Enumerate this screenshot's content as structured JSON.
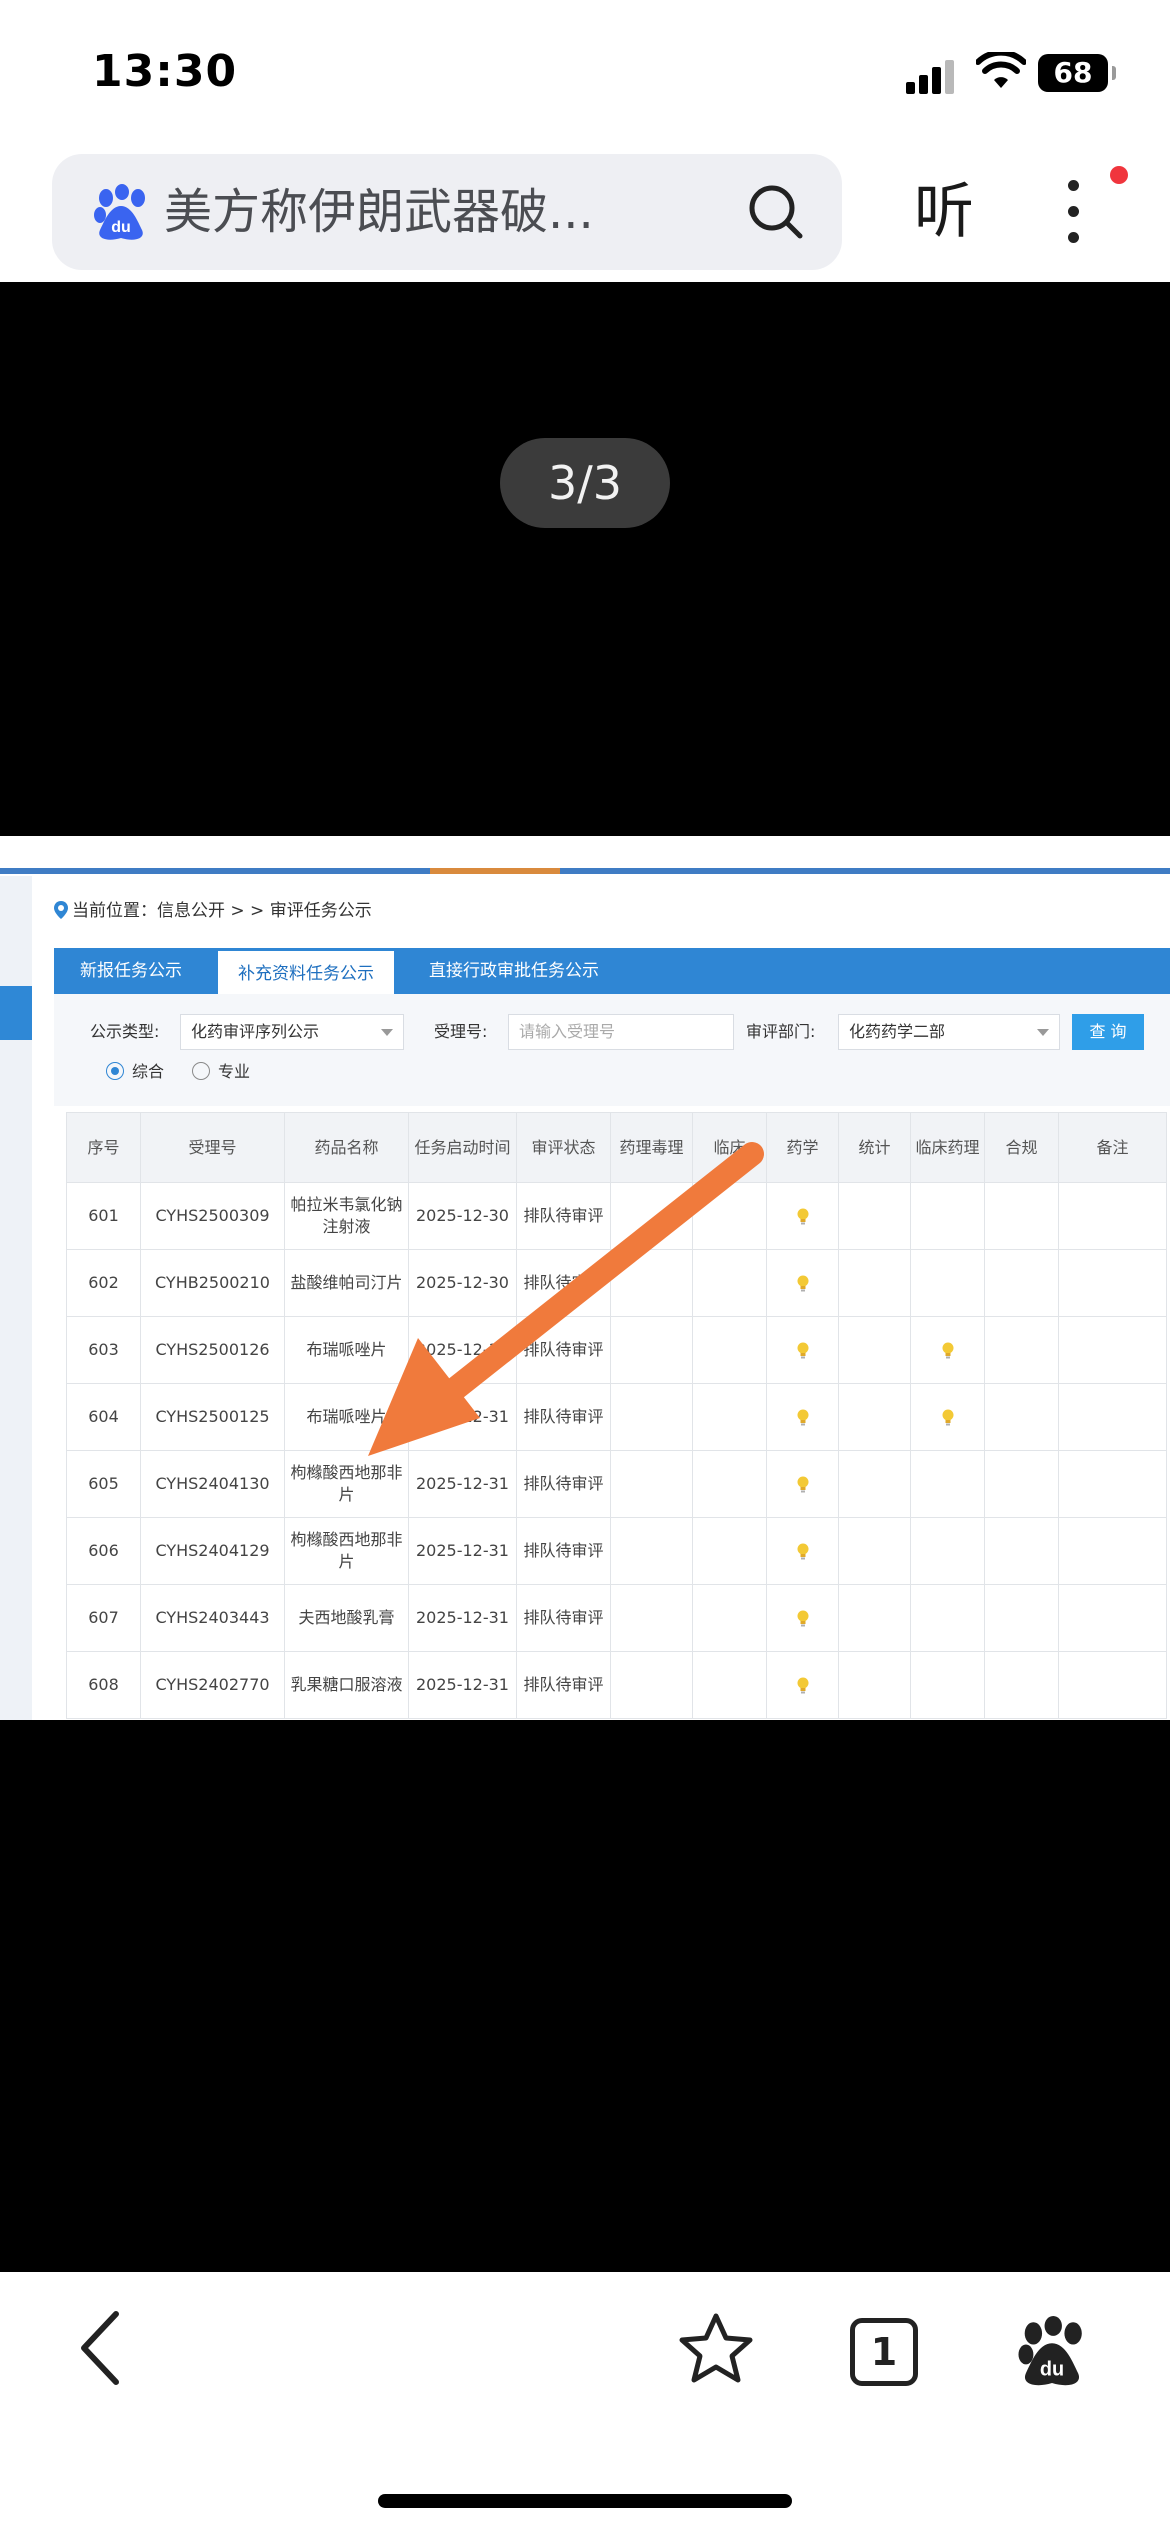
{
  "status": {
    "time": "13:30",
    "battery": "68"
  },
  "address_bar": {
    "query": "美方称伊朗武器破...",
    "listen_label": "听"
  },
  "viewer": {
    "counter": "3/3"
  },
  "page": {
    "breadcrumb": "当前位置：信息公开 > > 审评任务公示",
    "tabs": [
      "新报任务公示",
      "补充资料任务公示",
      "直接行政审批任务公示"
    ],
    "active_tab": 1,
    "filter": {
      "type_label": "公示类型:",
      "type_value": "化药审评序列公示",
      "accept_label": "受理号:",
      "accept_placeholder": "请输入受理号",
      "dept_label": "审评部门:",
      "dept_value": "化药药学二部",
      "query_button": "查 询",
      "radio_options": [
        "综合",
        "专业"
      ],
      "radio_selected": 0
    },
    "table": {
      "headers": [
        "序号",
        "受理号",
        "药品名称",
        "任务启动时间",
        "审评状态",
        "药理毒理",
        "临床",
        "药学",
        "统计",
        "临床药理",
        "合规",
        "备注"
      ],
      "rows": [
        {
          "no": "601",
          "accept": "CYHS2500309",
          "drug": "帕拉米韦氯化钠注射液",
          "date": "2025-12-30",
          "status": "排队待审评",
          "pharm": true,
          "clinpharm": false
        },
        {
          "no": "602",
          "accept": "CYHB2500210",
          "drug": "盐酸维帕司汀片",
          "date": "2025-12-30",
          "status": "排队待审评",
          "pharm": true,
          "clinpharm": false
        },
        {
          "no": "603",
          "accept": "CYHS2500126",
          "drug": "布瑞哌唑片",
          "date": "2025-12-31",
          "status": "排队待审评",
          "pharm": true,
          "clinpharm": true
        },
        {
          "no": "604",
          "accept": "CYHS2500125",
          "drug": "布瑞哌唑片",
          "date": "2025-12-31",
          "status": "排队待审评",
          "pharm": true,
          "clinpharm": true
        },
        {
          "no": "605",
          "accept": "CYHS2404130",
          "drug": "枸橼酸西地那非片",
          "date": "2025-12-31",
          "status": "排队待审评",
          "pharm": true,
          "clinpharm": false
        },
        {
          "no": "606",
          "accept": "CYHS2404129",
          "drug": "枸橼酸西地那非片",
          "date": "2025-12-31",
          "status": "排队待审评",
          "pharm": true,
          "clinpharm": false
        },
        {
          "no": "607",
          "accept": "CYHS2403443",
          "drug": "夫西地酸乳膏",
          "date": "2025-12-31",
          "status": "排队待审评",
          "pharm": true,
          "clinpharm": false
        },
        {
          "no": "608",
          "accept": "CYHS2402770",
          "drug": "乳果糖口服溶液",
          "date": "2025-12-31",
          "status": "排队待审评",
          "pharm": true,
          "clinpharm": false
        }
      ]
    }
  },
  "colors": {
    "accent_blue": "#2f86d4",
    "arrow_orange": "#f07a3c",
    "notif_red": "#f0353d"
  },
  "icons": [
    "baidu-paw-icon",
    "search-icon",
    "more-icon",
    "back-icon",
    "star-icon",
    "tab-count-icon",
    "location-pin-icon",
    "bulb-icon"
  ],
  "bottom_bar": {
    "tab_count": "1"
  }
}
